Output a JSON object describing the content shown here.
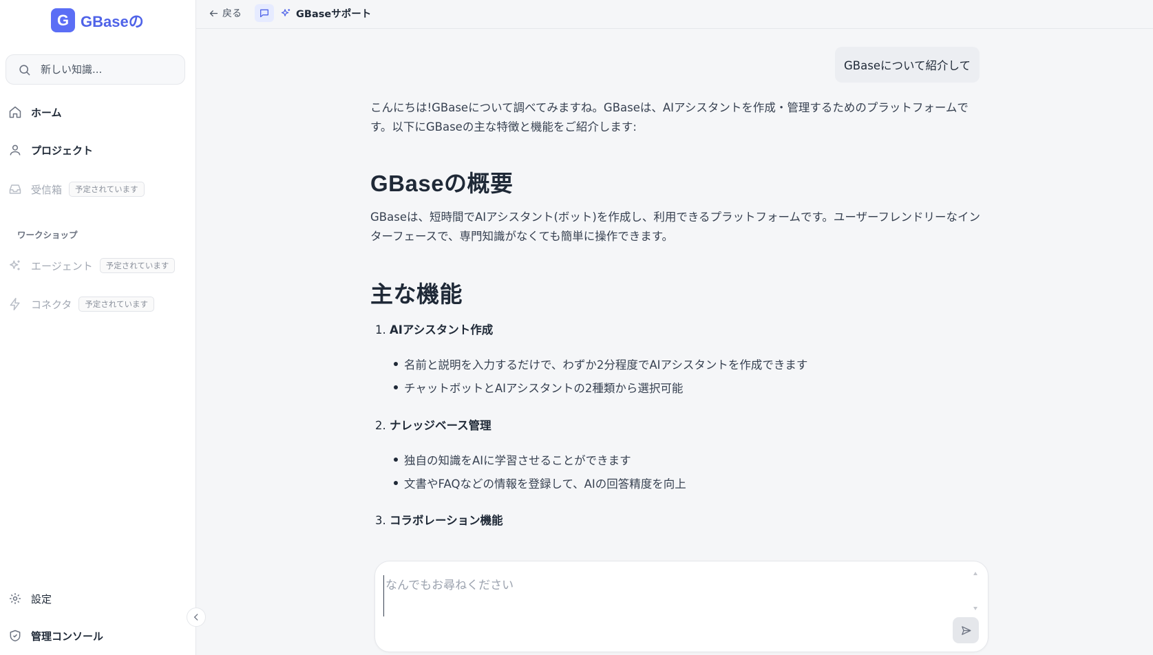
{
  "app": {
    "logo_letter": "G",
    "logo_name": "GBaseの",
    "brand_color": "#5b6ef5"
  },
  "sidebar": {
    "search_placeholder": "新しい知識...",
    "items": [
      {
        "label": "ホーム",
        "icon": "home-icon"
      },
      {
        "label": "プロジェクト",
        "icon": "user-icon"
      },
      {
        "label": "受信箱",
        "icon": "inbox-icon",
        "badge": "予定されています",
        "disabled": true
      }
    ],
    "section_label": "ワークショップ",
    "workshop_items": [
      {
        "label": "エージェント",
        "icon": "sparkle-icon",
        "badge": "予定されています",
        "disabled": true
      },
      {
        "label": "コネクタ",
        "icon": "lightning-icon",
        "badge": "予定されています",
        "disabled": true
      }
    ],
    "footer_items": [
      {
        "label": "設定",
        "icon": "gear-icon"
      },
      {
        "label": "管理コンソール",
        "icon": "shield-icon"
      }
    ]
  },
  "topbar": {
    "back_label": "戻る",
    "assistant_name": "GBaseサポート"
  },
  "chat": {
    "user_message": "GBaseについて紹介して",
    "intro": "こんにちは!GBaseについて調べてみますね。GBaseは、AIアシスタントを作成・管理するためのプラットフォームです。以下にGBaseの主な特徴と機能をご紹介します:",
    "overview_heading": "GBaseの概要",
    "overview_text": "GBaseは、短時間でAIアシスタント(ボット)を作成し、利用できるプラットフォームです。ユーザーフレンドリーなインターフェースで、専門知識がなくても簡単に操作できます。",
    "features_heading": "主な機能",
    "features": [
      {
        "number": "1.",
        "title": "AIアシスタント作成",
        "points": [
          "名前と説明を入力するだけで、わずか2分程度でAIアシスタントを作成できます",
          "チャットボットとAIアシスタントの2種類から選択可能"
        ]
      },
      {
        "number": "2.",
        "title": "ナレッジベース管理",
        "points": [
          "独自の知識をAIに学習させることができます",
          "文書やFAQなどの情報を登録して、AIの回答精度を向上"
        ]
      },
      {
        "number": "3.",
        "title": "コラボレーション機能",
        "points": []
      }
    ]
  },
  "composer": {
    "placeholder": "なんでもお尋ねください"
  }
}
